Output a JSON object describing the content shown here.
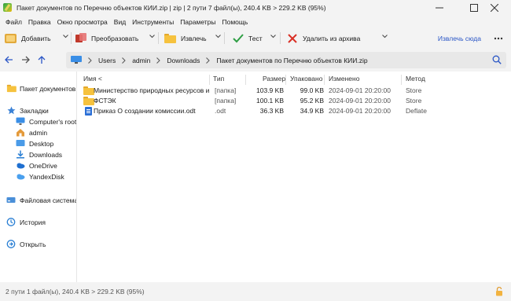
{
  "window": {
    "title": "Пакет документов по Перечню объектов КИИ.zip | zip | 2 пути 7 файл(ы), 240.4 KB > 229.2 KB (95%)"
  },
  "menu": [
    "Файл",
    "Правка",
    "Окно просмотра",
    "Вид",
    "Инструменты",
    "Параметры",
    "Помощь"
  ],
  "toolbar": {
    "add": "Добавить",
    "convert": "Преобразовать",
    "extract": "Извлечь",
    "test": "Тест",
    "delete": "Удалить из архива",
    "extract_here": "Извлечь сюда"
  },
  "breadcrumb": [
    "Users",
    "admin",
    "Downloads",
    "Пакет документов по Перечню объектов КИИ.zip"
  ],
  "sidebar": {
    "current_archive": "Пакет документов по Перечню объектов КИИ.zip",
    "bookmarks": "Закладки",
    "bookmark_items": [
      "Computer's root",
      "admin",
      "Desktop",
      "Downloads",
      "OneDrive",
      "YandexDisk"
    ],
    "filesystem": "Файловая система",
    "history": "История",
    "open": "Открыть"
  },
  "columns": {
    "name": "Имя <",
    "type": "Тип",
    "size": "Размер",
    "packed": "Упаковано",
    "modified": "Изменено",
    "method": "Метод"
  },
  "files": [
    {
      "name": "Министерство природных ресурсов и экологии",
      "type": "[папка]",
      "size": "103.9 KB",
      "packed": "99.0 KB",
      "modified": "2024-09-01 20:20:00",
      "method": "Store",
      "kind": "folder"
    },
    {
      "name": "ФСТЭК",
      "type": "[папка]",
      "size": "100.1 KB",
      "packed": "95.2 KB",
      "modified": "2024-09-01 20:20:00",
      "method": "Store",
      "kind": "folder"
    },
    {
      "name": "Приказ О создании комиссии.odt",
      "type": ".odt",
      "size": "36.3 KB",
      "packed": "34.9 KB",
      "modified": "2024-09-01 20:20:00",
      "method": "Deflate",
      "kind": "document"
    }
  ],
  "status": "2 пути 1 файл(ы), 240.4 KB > 229.2 KB (95%)",
  "colors": {
    "accent_link": "#2a56c6",
    "folder": "#f6c23e",
    "check_green": "#2e9e44",
    "delete_red": "#d93025",
    "bar_bg": "#f3f3f3"
  }
}
